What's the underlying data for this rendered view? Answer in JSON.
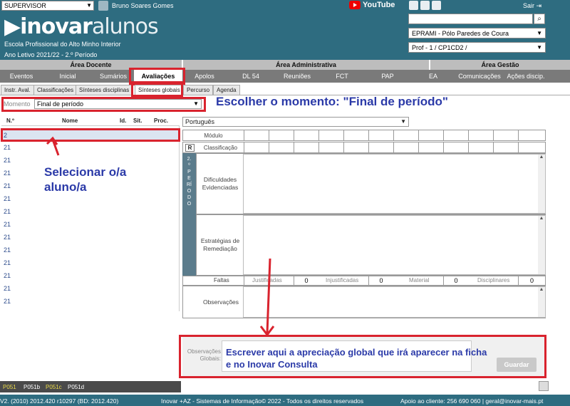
{
  "topbar": {
    "role": "SUPERVISOR",
    "user_name": "Bruno Soares Gomes",
    "youtube_label": "YouTube",
    "exit_label": "Sair"
  },
  "header": {
    "logo_main": "inovar",
    "logo_sub": "alunos",
    "school": "Escola Profissional do Alto Minho Interior",
    "school_year": "Ano Letivo 2021/22 - 2.º Período",
    "site_select": "EPRAMI - Pólo Paredes de Coura",
    "class_select": "Prof - 1 / CP1CD2 /"
  },
  "areas": {
    "docente": "Área Docente",
    "administrativa": "Área Administrativa",
    "gestao": "Área Gestão"
  },
  "menu": [
    "Eventos",
    "Inicial",
    "Sumários",
    "Avaliações",
    "Apolos",
    "DL 54",
    "Reuniões",
    "FCT",
    "PAP",
    "EA",
    "Comunicações",
    "Ações discip."
  ],
  "subtabs": [
    "Instr. Aval.",
    "Classificações",
    "Sínteses disciplinas",
    "Sínteses globais",
    "Percurso",
    "Agenda"
  ],
  "moment": {
    "label": "Momento",
    "value": "Final de período"
  },
  "callouts": {
    "moment": "Escolher o momento: \"Final de período\"",
    "student": "Selecionar o/a aluno/a",
    "write": "Escrever aqui a apreciação global que irá aparecer na ficha e no Inovar Consulta"
  },
  "table": {
    "headers": [
      "N.º",
      "Nome",
      "Id.",
      "Sit.",
      "Proc."
    ],
    "rows": [
      "2",
      "21",
      "21",
      "21",
      "21",
      "21",
      "21",
      "21",
      "21",
      "21",
      "21",
      "21",
      "21",
      "21"
    ]
  },
  "subject": "Português",
  "grid": {
    "modulo": "Módulo",
    "classificacao": "Classificação",
    "r_button": "R",
    "period": "2.º PERÍODO"
  },
  "fields": {
    "dificuldades": "Dificuldades Evidenciadas",
    "estrategias": "Estratégias de Remediação",
    "faltas": "Faltas",
    "observacoes": "Observações",
    "obs_globais": "Observações Globais:"
  },
  "faltas": [
    {
      "label": "Justificadas",
      "value": "0"
    },
    {
      "label": "Injustificadas",
      "value": "0"
    },
    {
      "label": "Material",
      "value": "0"
    },
    {
      "label": "Disciplinares",
      "value": "0"
    }
  ],
  "save_label": "Guardar",
  "legend": [
    "P051",
    "P051b",
    "P051c",
    "P051d"
  ],
  "footer": {
    "version": "V2. (2010) 2012.420 r10297 (BD: 2012.420)",
    "copyright": "Inovar +AZ - Sistemas de Informação© 2022 - Todos os direitos reservados",
    "support": "Apoio ao cliente: 256 690 060 | geral@inovar-mais.pt"
  }
}
